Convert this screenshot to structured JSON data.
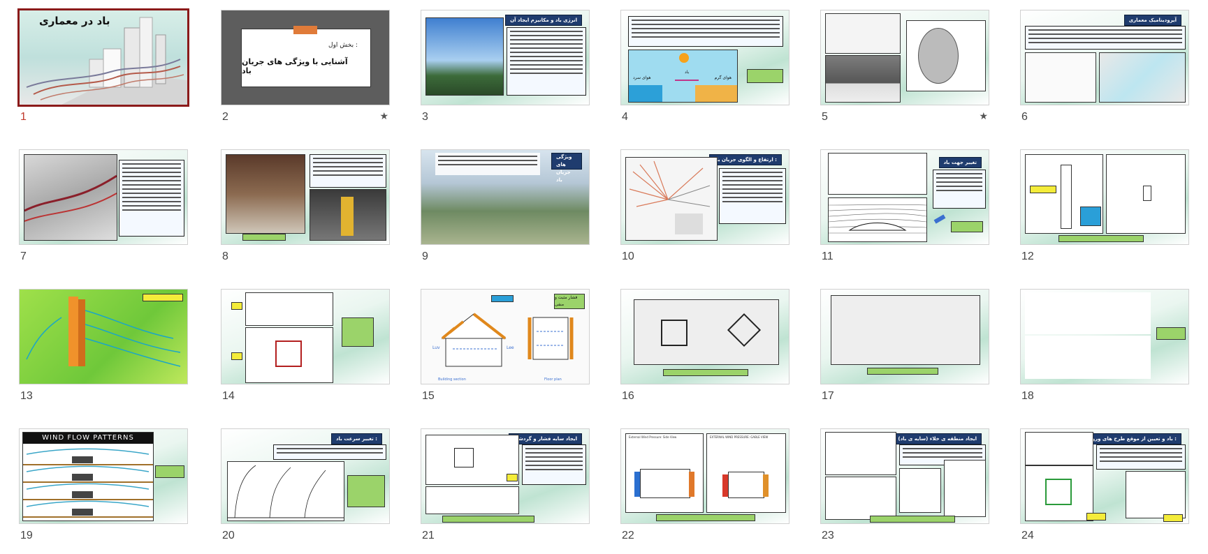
{
  "slides": [
    {
      "number": "1",
      "selected": true,
      "title": "باد در معماری"
    },
    {
      "number": "2",
      "starred": true,
      "heading": "بخش اول :",
      "subheading": "آشنایی با ویژگی های جریان باد"
    },
    {
      "number": "3",
      "title": "انرژی باد و مکانیزم ایجاد آن"
    },
    {
      "number": "4",
      "label_cold": "هوای سرد",
      "label_warm": "هوای گرم",
      "label_wind": "باد"
    },
    {
      "number": "5",
      "starred": true
    },
    {
      "number": "6",
      "title": "آیرودینامیک معماری"
    },
    {
      "number": "7"
    },
    {
      "number": "8"
    },
    {
      "number": "9",
      "title": "ویژگی های جریان باد"
    },
    {
      "number": "10",
      "title": "ارتفاع و الگوی جریان باد :"
    },
    {
      "number": "11",
      "title": "تغییر جهت باد"
    },
    {
      "number": "12"
    },
    {
      "number": "13"
    },
    {
      "number": "14"
    },
    {
      "number": "15",
      "title": "فشار مثبت و منفی",
      "label_luv": "Luv",
      "label_lee": "Lee",
      "label_section": "Building section",
      "label_plan": "Floor plan"
    },
    {
      "number": "16"
    },
    {
      "number": "17"
    },
    {
      "number": "18"
    },
    {
      "number": "19",
      "title": "WIND FLOW PATTERNS"
    },
    {
      "number": "20",
      "title": "تغییر سرعت باد :"
    },
    {
      "number": "21",
      "title": "ایجاد سایه فشار و گردشی"
    },
    {
      "number": "22",
      "title_left": "External Wind Pressure: Side View",
      "title_right": "EXTERNAL WIND PRESSURE: GABLE VIEW"
    },
    {
      "number": "23",
      "title": "ایجاد منطقه ی خلاء (سایه ی باد)"
    },
    {
      "number": "24",
      "title": "باد و تعیین از موقع طرح های ورودی و درب ورودی :"
    }
  ],
  "colors": {
    "selected_border": "#8b1a1a",
    "selected_number": "#c0392b",
    "title_box": "#1f3c6e",
    "tag_green": "#9bd36a",
    "tag_yellow": "#f4ec3a"
  }
}
